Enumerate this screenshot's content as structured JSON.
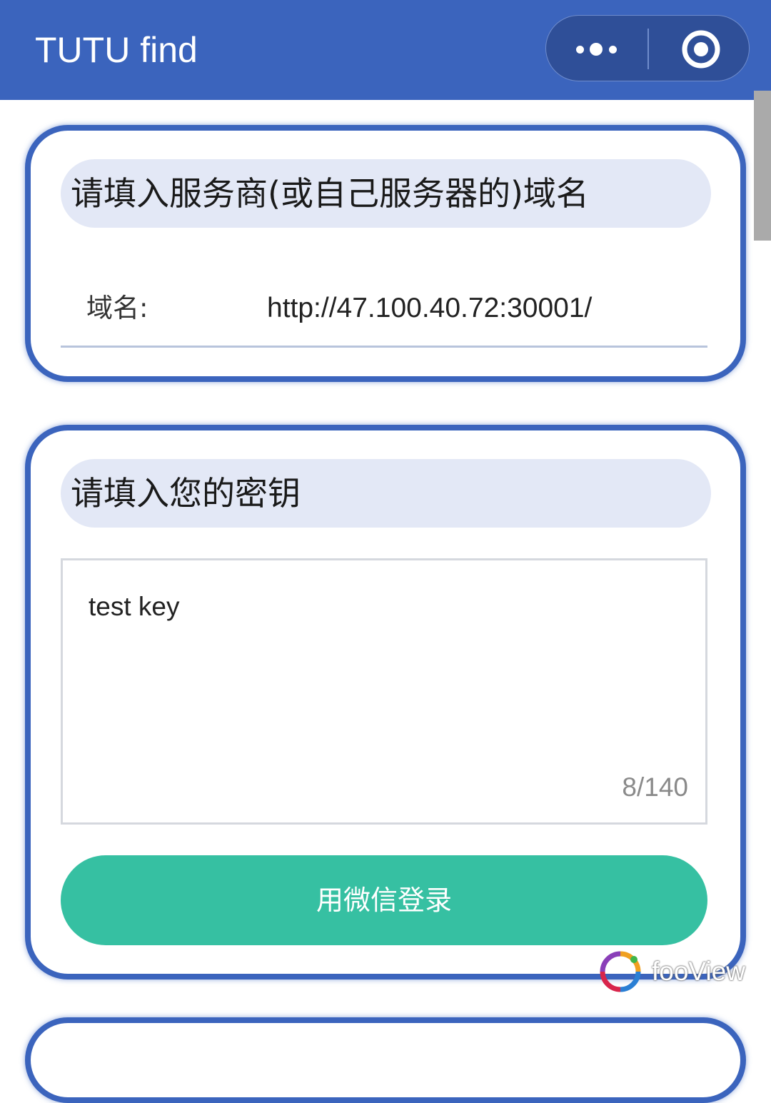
{
  "header": {
    "title": "TUTU find",
    "more_icon": "more-dots-icon",
    "close_icon": "target-circle-icon",
    "background_color": "#3b64bd"
  },
  "domain_card": {
    "heading": "请填入服务商(或自己服务器的)域名",
    "label": "域名:",
    "value": "http://47.100.40.72:30001/"
  },
  "key_card": {
    "heading": "请填入您的密钥",
    "textarea_value": "test key",
    "counter": "8/140",
    "login_button": "用微信登录",
    "button_color": "#36c0a2"
  },
  "watermark": {
    "text": "fooView",
    "icon": "fooview-logo-icon"
  }
}
